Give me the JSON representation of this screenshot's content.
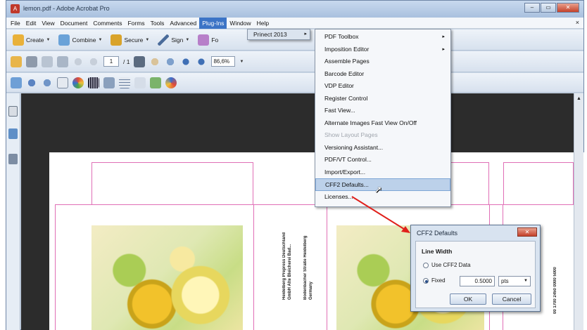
{
  "window": {
    "title": "lemon.pdf - Adobe Acrobat Pro",
    "controls": {
      "minimize": "–",
      "maximize": "▭",
      "close": "✕"
    }
  },
  "menubar": {
    "items": [
      "File",
      "Edit",
      "View",
      "Document",
      "Comments",
      "Forms",
      "Tools",
      "Advanced",
      "Plug-Ins",
      "Window",
      "Help"
    ],
    "active": "Plug-Ins",
    "close_glyph": "×"
  },
  "toolbar1": {
    "create": "Create",
    "combine": "Combine",
    "secure": "Secure",
    "sign": "Sign",
    "forms": "Fo"
  },
  "toolbar2": {
    "page_current": "1",
    "page_total": "/ 1",
    "zoom": "86,6%"
  },
  "plugins_menu": {
    "item": "Prinect 2013",
    "submenu_arrow": "▸"
  },
  "prinect_menu": {
    "items": [
      {
        "label": "PDF Toolbox",
        "sub": "▸",
        "disabled": false
      },
      {
        "label": "Imposition Editor",
        "sub": "▸",
        "disabled": false
      },
      {
        "label": "Assemble Pages",
        "sub": "",
        "disabled": false
      },
      {
        "label": "Barcode Editor",
        "sub": "",
        "disabled": false
      },
      {
        "label": "VDP Editor",
        "sub": "",
        "disabled": false
      },
      {
        "label": "Register Control",
        "sub": "",
        "disabled": false
      },
      {
        "label": "Fast View...",
        "sub": "",
        "disabled": false
      },
      {
        "label": "Alternate Images Fast View On/Off",
        "sub": "",
        "disabled": false
      },
      {
        "label": "Show Layout Pages",
        "sub": "",
        "disabled": true
      },
      {
        "label": "Versioning Assistant...",
        "sub": "",
        "disabled": false
      },
      {
        "label": "PDF/VT Control...",
        "sub": "",
        "disabled": false
      },
      {
        "label": "Import/Export...",
        "sub": "",
        "disabled": false
      },
      {
        "label": "CFF2 Defaults...",
        "sub": "",
        "disabled": false
      },
      {
        "label": "Licenses...",
        "sub": "",
        "disabled": false
      }
    ],
    "highlighted": "CFF2 Defaults..."
  },
  "dialog": {
    "title": "CFF2 Defaults",
    "close_glyph": "✕",
    "group_label": "Line Width",
    "option_use": "Use CFF2 Data",
    "option_fixed": "Fixed",
    "selected_option": "Fixed",
    "fixed_value": "0.5000",
    "unit": "pts",
    "ok": "OK",
    "cancel": "Cancel"
  },
  "document": {
    "panel_text_1": "Heidelberg Prepress Deutschland GmbH Alte Bleicherei Bad...",
    "panel_text_2": "Bodenbacher Straße Heidelberg Germany",
    "panel_text_3": "00 1700 2450 0000 5000"
  },
  "colors": {
    "dieline": "#e06fb6",
    "menu_active": "#3c74c6",
    "highlight": "#bcd1ea",
    "annotation_arrow": "#e0201b"
  }
}
